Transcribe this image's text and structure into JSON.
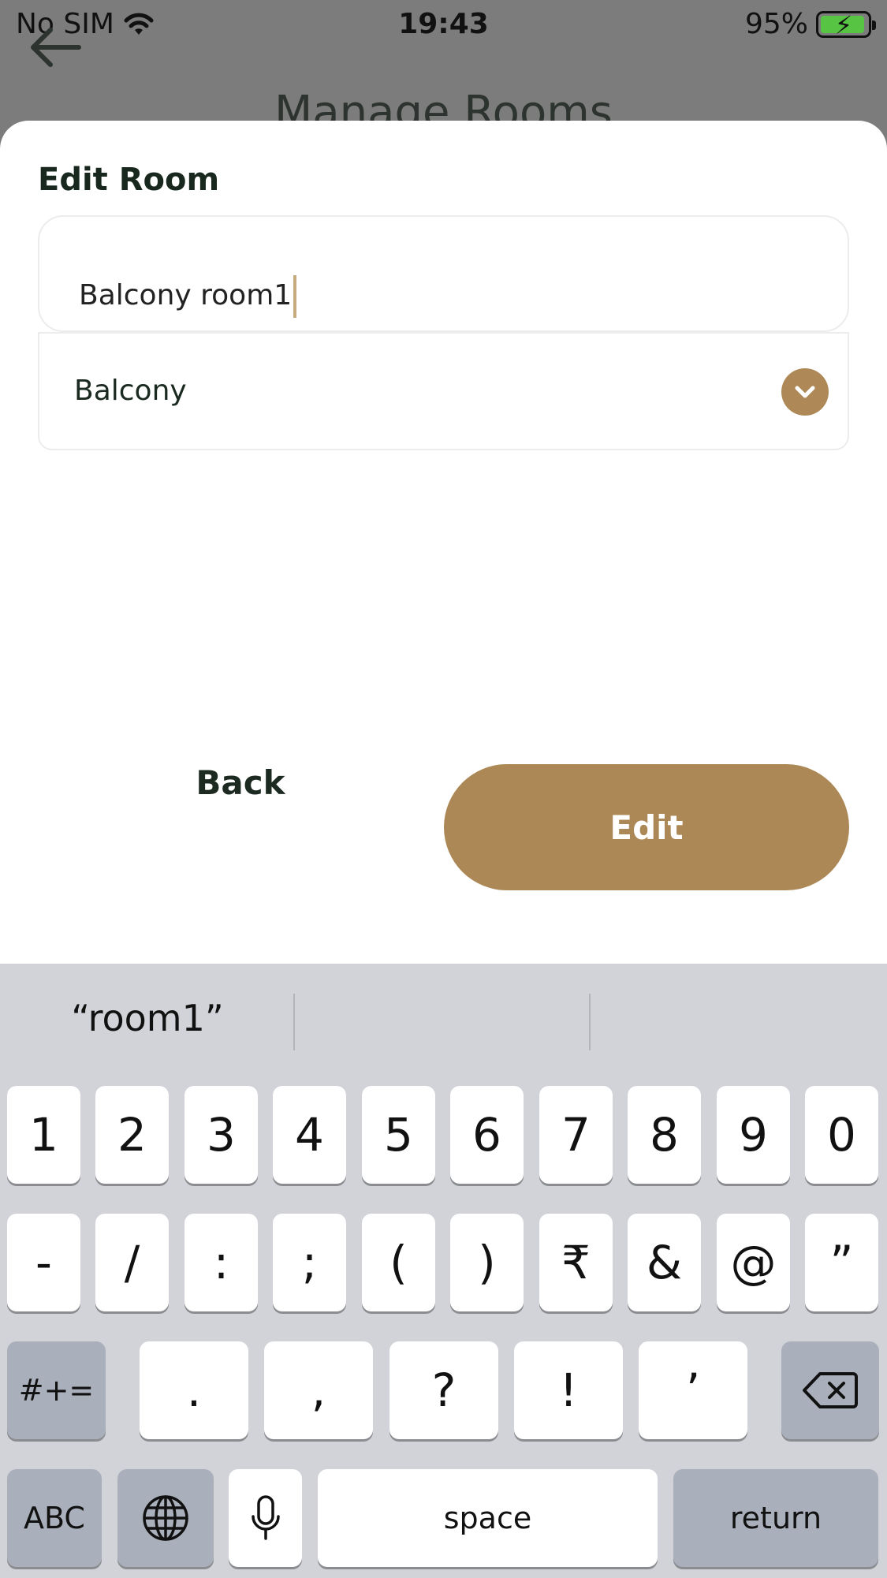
{
  "status_bar": {
    "carrier": "No SIM",
    "time": "19:43",
    "battery": "95%",
    "battery_level": 0.95
  },
  "background": {
    "title": "Manage Rooms"
  },
  "sheet": {
    "title": "Edit Room",
    "name_value": "Balcony room1",
    "room_type": "Balcony",
    "back_label": "Back",
    "edit_label": "Edit"
  },
  "colors": {
    "accent": "#ad8857",
    "title_text": "#18281f"
  },
  "keyboard": {
    "suggestions": [
      "“room1”",
      "",
      ""
    ],
    "row1": [
      "1",
      "2",
      "3",
      "4",
      "5",
      "6",
      "7",
      "8",
      "9",
      "0"
    ],
    "row2": [
      "-",
      "/",
      ":",
      ";",
      "(",
      ")",
      "₹",
      "&",
      "@",
      "”"
    ],
    "row3": [
      ".",
      ",",
      "?",
      "!",
      "’"
    ],
    "symbols_label": "#+=",
    "abc_label": "ABC",
    "space_label": "space",
    "return_label": "return"
  }
}
